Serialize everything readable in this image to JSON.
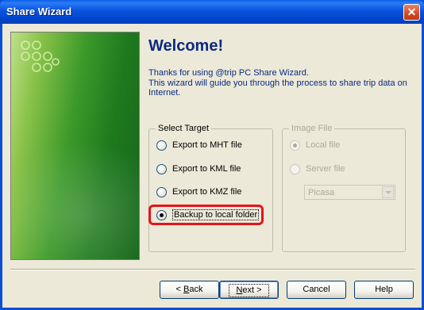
{
  "window": {
    "title": "Share Wizard"
  },
  "welcome": {
    "heading": "Welcome!",
    "line1": "Thanks for using @trip PC Share Wizard.",
    "line2": "This wizard will guide you through the process to share trip data on",
    "line3": "Internet."
  },
  "select_target": {
    "legend": "Select Target",
    "options": [
      {
        "label": "Export to MHT file",
        "checked": false
      },
      {
        "label": "Export to KML file",
        "checked": false
      },
      {
        "label": "Export to KMZ file",
        "checked": false
      },
      {
        "label": "Backup to local folder",
        "checked": true
      }
    ]
  },
  "image_file": {
    "legend": "Image File",
    "options": [
      {
        "label": "Local file",
        "checked": true
      },
      {
        "label": "Server file",
        "checked": false
      }
    ],
    "server": {
      "selected": "Picasa"
    }
  },
  "buttons": {
    "back": {
      "prefix": "< ",
      "accel": "B",
      "rest": "ack"
    },
    "next": {
      "accel": "N",
      "rest": "ext >"
    },
    "cancel": "Cancel",
    "help": "Help"
  },
  "colors": {
    "highlight": "#e8121b",
    "heading": "#0b2a80"
  }
}
